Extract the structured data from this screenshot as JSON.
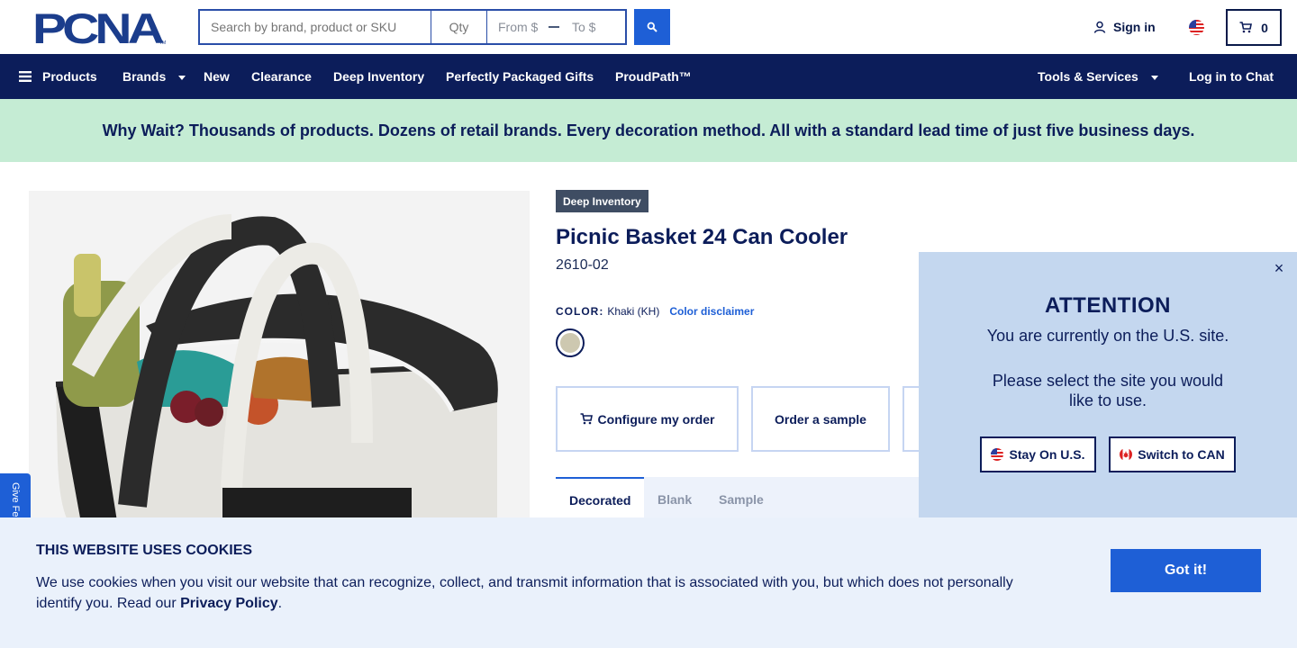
{
  "header": {
    "logo_text": "PCNA",
    "search_placeholder": "Search by brand, product or SKU",
    "qty_placeholder": "Qty",
    "price_from": "From $",
    "price_to": "To $",
    "sign_in": "Sign in",
    "cart_count": "0"
  },
  "nav": {
    "items": [
      "Products",
      "Brands",
      "New",
      "Clearance",
      "Deep Inventory",
      "Perfectly Packaged Gifts",
      "ProudPath™"
    ],
    "tools": "Tools & Services",
    "chat": "Log in to Chat"
  },
  "promo": {
    "text": "Why Wait? Thousands of products. Dozens of retail brands. Every decoration method. All with a standard lead time of just five business days."
  },
  "product": {
    "badge": "Deep Inventory",
    "title": "Picnic Basket 24 Can Cooler",
    "sku": "2610-02",
    "color_label": "COLOR:",
    "color_value": "Khaki (KH)",
    "color_disclaimer": "Color disclaimer",
    "swatch_color": "#cdc8b0",
    "actions": [
      "Configure my order",
      "Order a sample"
    ],
    "tabs": [
      "Decorated",
      "Blank",
      "Sample"
    ]
  },
  "feedback": {
    "label": "Give Feedback"
  },
  "modal": {
    "close": "×",
    "title": "ATTENTION",
    "line1": "You are currently on the U.S. site.",
    "line2": "Please select the site you would like to use.",
    "stay": "Stay On U.S.",
    "switch": "Switch to CAN"
  },
  "cookie": {
    "title": "THIS WEBSITE USES COOKIES",
    "text": "We use cookies when you visit our website that can recognize, collect, and transmit information that is associated with you, but which does not personally identify you. Read our",
    "link": "Privacy Policy",
    "period": ".",
    "button": "Got it!"
  },
  "colors": {
    "navy": "#0c1d5a",
    "accent": "#1e5fd6",
    "promo_bg": "#c5ecd4",
    "modal_bg": "#c4d7ef",
    "cookie_bg": "#eaf1fb"
  }
}
